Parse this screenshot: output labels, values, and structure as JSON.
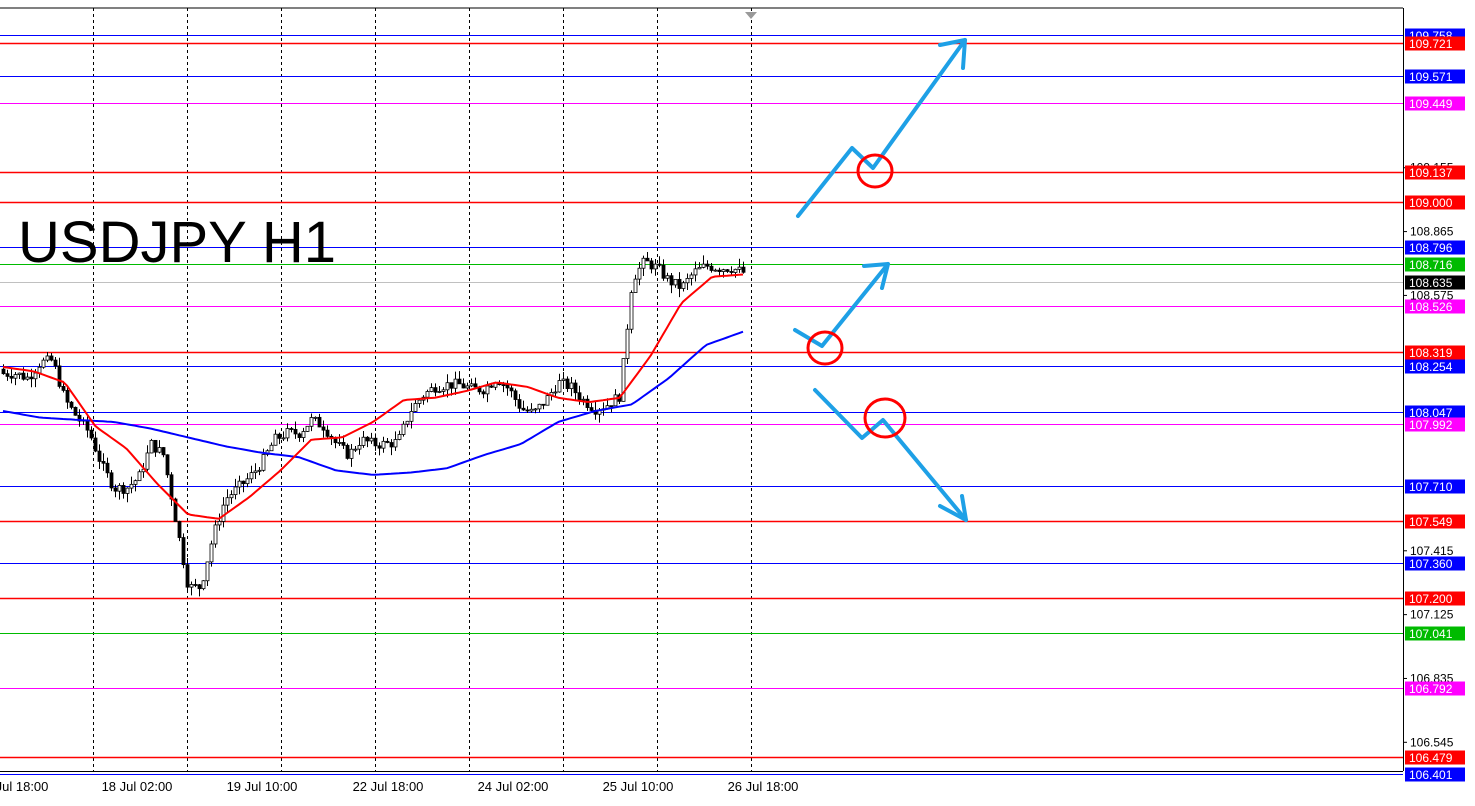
{
  "chart_data": {
    "type": "candlestick",
    "title": "USDJPY H1",
    "symbol": "USDJPY",
    "timeframe": "H1",
    "ylim": [
      106.38,
      109.78
    ],
    "x_tick_labels": [
      "Jul 18:00",
      "18 Jul 02:00",
      "19 Jul 10:00",
      "22 Jul 18:00",
      "24 Jul 02:00",
      "25 Jul 10:00",
      "26 Jul 18:00"
    ],
    "y_tick_labels": [
      109.155,
      108.865,
      108.575,
      107.415,
      107.125,
      106.835,
      106.545
    ],
    "current_price": {
      "value": 108.635,
      "label": "108.635"
    },
    "horizontal_levels": [
      {
        "value": 109.758,
        "label": "109.758",
        "color": "#0000ff",
        "type": "resistance"
      },
      {
        "value": 109.721,
        "label": "109.721",
        "color": "#ff0000",
        "type": "resistance"
      },
      {
        "value": 109.571,
        "label": "109.571",
        "color": "#0000ff",
        "type": "resistance"
      },
      {
        "value": 109.449,
        "label": "109.449",
        "color": "#ff00ff",
        "type": "resistance"
      },
      {
        "value": 109.137,
        "label": "109.137",
        "color": "#ff0000",
        "type": "resistance"
      },
      {
        "value": 109.0,
        "label": "109.000",
        "color": "#ff0000",
        "type": "resistance"
      },
      {
        "value": 108.796,
        "label": "108.796",
        "color": "#0000ff",
        "type": "resistance"
      },
      {
        "value": 108.716,
        "label": "108.716",
        "color": "#00bb00",
        "type": "level"
      },
      {
        "value": 108.526,
        "label": "108.526",
        "color": "#ff00ff",
        "type": "support"
      },
      {
        "value": 108.319,
        "label": "108.319",
        "color": "#ff0000",
        "type": "support"
      },
      {
        "value": 108.254,
        "label": "108.254",
        "color": "#0000ff",
        "type": "support"
      },
      {
        "value": 108.047,
        "label": "108.047",
        "color": "#0000ff",
        "type": "support"
      },
      {
        "value": 107.992,
        "label": "107.992",
        "color": "#ff00ff",
        "type": "support"
      },
      {
        "value": 107.71,
        "label": "107.710",
        "color": "#0000ff",
        "type": "support"
      },
      {
        "value": 107.549,
        "label": "107.549",
        "color": "#ff0000",
        "type": "support"
      },
      {
        "value": 107.36,
        "label": "107.360",
        "color": "#0000ff",
        "type": "support"
      },
      {
        "value": 107.2,
        "label": "107.200",
        "color": "#ff0000",
        "type": "support"
      },
      {
        "value": 107.041,
        "label": "107.041",
        "color": "#00bb00",
        "type": "level"
      },
      {
        "value": 106.792,
        "label": "106.792",
        "color": "#ff00ff",
        "type": "support"
      },
      {
        "value": 106.479,
        "label": "106.479",
        "color": "#ff0000",
        "type": "support"
      },
      {
        "value": 106.401,
        "label": "106.401",
        "color": "#0000ff",
        "type": "support"
      }
    ],
    "price_anchors": [
      108.22,
      108.22,
      108.2,
      108.27,
      108.28,
      108.1,
      108.02,
      107.95,
      107.8,
      107.7,
      107.7,
      107.75,
      107.9,
      107.85,
      107.55,
      107.25,
      107.25,
      107.48,
      107.65,
      107.7,
      107.75,
      107.82,
      107.92,
      107.95,
      107.95,
      108.01,
      107.98,
      107.9,
      107.85,
      107.92,
      107.9,
      107.9,
      107.91,
      108.05,
      108.12,
      108.16,
      108.17,
      108.17,
      108.15,
      108.15,
      108.2,
      108.15,
      108.06,
      108.04,
      108.1,
      108.18,
      108.16,
      108.1,
      108.06,
      108.08,
      108.12,
      108.65,
      108.73,
      108.7,
      108.64,
      108.61,
      108.68,
      108.71,
      108.7,
      108.7,
      108.68
    ],
    "ma_fast_anchors": [
      108.25,
      108.23,
      108.18,
      107.98,
      107.88,
      107.72,
      107.58,
      107.56,
      107.66,
      107.78,
      107.92,
      107.93,
      108.0,
      108.1,
      108.11,
      108.14,
      108.18,
      108.16,
      108.11,
      108.09,
      108.11,
      108.3,
      108.54,
      108.66,
      108.67
    ],
    "ma_slow_anchors": [
      108.05,
      108.02,
      108.01,
      108.0,
      107.97,
      107.93,
      107.89,
      107.86,
      107.84,
      107.78,
      107.76,
      107.77,
      107.79,
      107.85,
      107.9,
      108.0,
      108.05,
      108.08,
      108.2,
      108.35,
      108.41
    ],
    "scenario_markers": [
      "upside breakout scenario",
      "pullback and rise scenario",
      "breakdown scenario"
    ]
  },
  "colors": {
    "background": "#ffffff",
    "grid": "#000000",
    "bull_body": "#ffffff",
    "bear_body": "#000000",
    "ma_fast": "#ff0000",
    "ma_slow": "#0000ff",
    "arrows": "#1ea0e6",
    "circles": "#ff0000",
    "current_price_label_bg": "#000000"
  }
}
